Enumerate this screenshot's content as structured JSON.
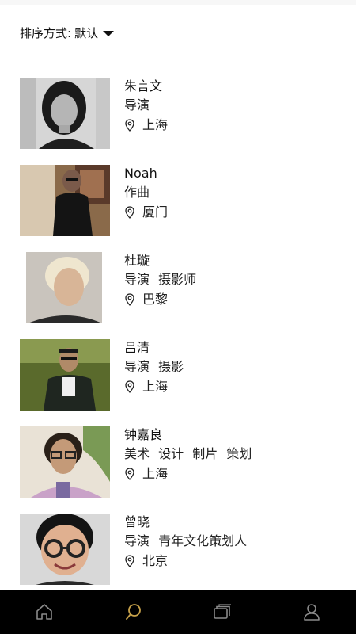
{
  "sort": {
    "label": "排序方式:",
    "value": "默认"
  },
  "people": [
    {
      "name": "朱言文",
      "roles": [
        "导演"
      ],
      "location": "上海"
    },
    {
      "name": "Noah",
      "roles": [
        "作曲"
      ],
      "location": "厦门"
    },
    {
      "name": "杜璇",
      "roles": [
        "导演",
        "摄影师"
      ],
      "location": "巴黎"
    },
    {
      "name": "吕清",
      "roles": [
        "导演",
        "摄影"
      ],
      "location": "上海"
    },
    {
      "name": "钟嘉良",
      "roles": [
        "美术",
        "设计",
        "制片",
        "策划"
      ],
      "location": "上海"
    },
    {
      "name": "曾晓",
      "roles": [
        "导演",
        "青年文化策划人"
      ],
      "location": "北京"
    }
  ],
  "tabbar": {
    "tabs": [
      {
        "icon": "home-icon",
        "active": false
      },
      {
        "icon": "search-icon",
        "active": true
      },
      {
        "icon": "cards-icon",
        "active": false
      },
      {
        "icon": "profile-icon",
        "active": false
      }
    ],
    "active_color": "#c8a24a",
    "inactive_color": "#8a8a8a"
  }
}
